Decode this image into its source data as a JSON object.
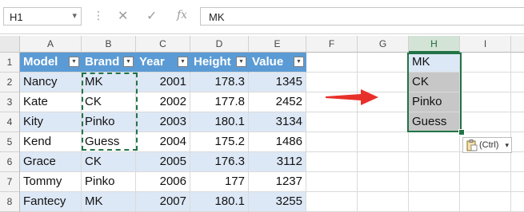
{
  "name_box": {
    "value": "H1",
    "dropdown_icon": "chevron-down-icon"
  },
  "formula_bar": {
    "cancel_icon": "close-icon",
    "enter_icon": "checkmark-icon",
    "function_icon": "fx-icon",
    "function_glyph": "fx",
    "value": "MK"
  },
  "columns": [
    "A",
    "B",
    "C",
    "D",
    "E",
    "F",
    "G",
    "H",
    "I"
  ],
  "selected_column": "H",
  "rows": [
    "1",
    "2",
    "3",
    "4",
    "5",
    "6",
    "7",
    "8"
  ],
  "table": {
    "headers": [
      "Model",
      "Brand",
      "Year",
      "Height",
      "Value"
    ],
    "rows": [
      [
        "Nancy",
        "MK",
        "2001",
        "178.3",
        "1345"
      ],
      [
        "Kate",
        "CK",
        "2002",
        "177.8",
        "2452"
      ],
      [
        "Kity",
        "Pinko",
        "2003",
        "180.1",
        "3134"
      ],
      [
        "Kend",
        "Guess",
        "2004",
        "175.2",
        "1486"
      ],
      [
        "Grace",
        "CK",
        "2005",
        "176.3",
        "3112"
      ],
      [
        "Tommy",
        "Pinko",
        "2006",
        "177",
        "1237"
      ],
      [
        "Fantecy",
        "MK",
        "2007",
        "180.1",
        "3255"
      ]
    ]
  },
  "pasted_column_h": [
    "MK",
    "CK",
    "Pinko",
    "Guess"
  ],
  "paste_options": {
    "label": "(Ctrl)",
    "icon": "clipboard-icon"
  },
  "colors": {
    "header_fill": "#5b9bd5",
    "band_fill": "#dde8f6",
    "selection": "#217346",
    "arrow": "#e8302a"
  }
}
